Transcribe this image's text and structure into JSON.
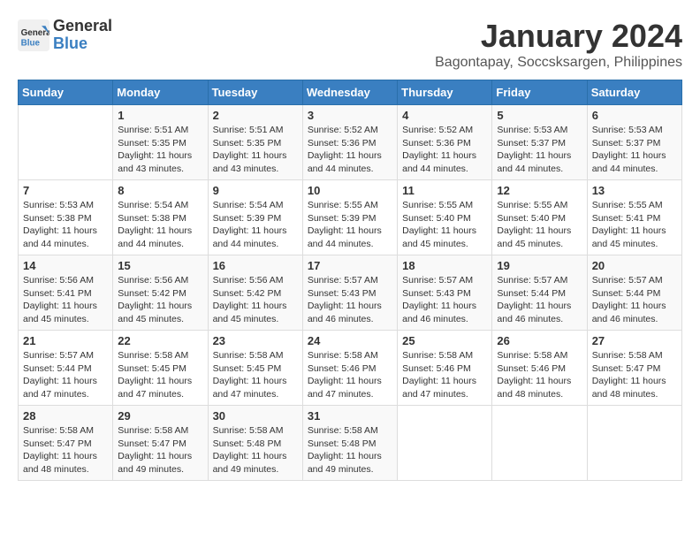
{
  "header": {
    "logo_line1": "General",
    "logo_line2": "Blue",
    "month_title": "January 2024",
    "location": "Bagontapay, Soccsksargen, Philippines"
  },
  "weekdays": [
    "Sunday",
    "Monday",
    "Tuesday",
    "Wednesday",
    "Thursday",
    "Friday",
    "Saturday"
  ],
  "weeks": [
    [
      {
        "day": "",
        "info": ""
      },
      {
        "day": "1",
        "info": "Sunrise: 5:51 AM\nSunset: 5:35 PM\nDaylight: 11 hours\nand 43 minutes."
      },
      {
        "day": "2",
        "info": "Sunrise: 5:51 AM\nSunset: 5:35 PM\nDaylight: 11 hours\nand 43 minutes."
      },
      {
        "day": "3",
        "info": "Sunrise: 5:52 AM\nSunset: 5:36 PM\nDaylight: 11 hours\nand 44 minutes."
      },
      {
        "day": "4",
        "info": "Sunrise: 5:52 AM\nSunset: 5:36 PM\nDaylight: 11 hours\nand 44 minutes."
      },
      {
        "day": "5",
        "info": "Sunrise: 5:53 AM\nSunset: 5:37 PM\nDaylight: 11 hours\nand 44 minutes."
      },
      {
        "day": "6",
        "info": "Sunrise: 5:53 AM\nSunset: 5:37 PM\nDaylight: 11 hours\nand 44 minutes."
      }
    ],
    [
      {
        "day": "7",
        "info": "Sunrise: 5:53 AM\nSunset: 5:38 PM\nDaylight: 11 hours\nand 44 minutes."
      },
      {
        "day": "8",
        "info": "Sunrise: 5:54 AM\nSunset: 5:38 PM\nDaylight: 11 hours\nand 44 minutes."
      },
      {
        "day": "9",
        "info": "Sunrise: 5:54 AM\nSunset: 5:39 PM\nDaylight: 11 hours\nand 44 minutes."
      },
      {
        "day": "10",
        "info": "Sunrise: 5:55 AM\nSunset: 5:39 PM\nDaylight: 11 hours\nand 44 minutes."
      },
      {
        "day": "11",
        "info": "Sunrise: 5:55 AM\nSunset: 5:40 PM\nDaylight: 11 hours\nand 45 minutes."
      },
      {
        "day": "12",
        "info": "Sunrise: 5:55 AM\nSunset: 5:40 PM\nDaylight: 11 hours\nand 45 minutes."
      },
      {
        "day": "13",
        "info": "Sunrise: 5:55 AM\nSunset: 5:41 PM\nDaylight: 11 hours\nand 45 minutes."
      }
    ],
    [
      {
        "day": "14",
        "info": "Sunrise: 5:56 AM\nSunset: 5:41 PM\nDaylight: 11 hours\nand 45 minutes."
      },
      {
        "day": "15",
        "info": "Sunrise: 5:56 AM\nSunset: 5:42 PM\nDaylight: 11 hours\nand 45 minutes."
      },
      {
        "day": "16",
        "info": "Sunrise: 5:56 AM\nSunset: 5:42 PM\nDaylight: 11 hours\nand 45 minutes."
      },
      {
        "day": "17",
        "info": "Sunrise: 5:57 AM\nSunset: 5:43 PM\nDaylight: 11 hours\nand 46 minutes."
      },
      {
        "day": "18",
        "info": "Sunrise: 5:57 AM\nSunset: 5:43 PM\nDaylight: 11 hours\nand 46 minutes."
      },
      {
        "day": "19",
        "info": "Sunrise: 5:57 AM\nSunset: 5:44 PM\nDaylight: 11 hours\nand 46 minutes."
      },
      {
        "day": "20",
        "info": "Sunrise: 5:57 AM\nSunset: 5:44 PM\nDaylight: 11 hours\nand 46 minutes."
      }
    ],
    [
      {
        "day": "21",
        "info": "Sunrise: 5:57 AM\nSunset: 5:44 PM\nDaylight: 11 hours\nand 47 minutes."
      },
      {
        "day": "22",
        "info": "Sunrise: 5:58 AM\nSunset: 5:45 PM\nDaylight: 11 hours\nand 47 minutes."
      },
      {
        "day": "23",
        "info": "Sunrise: 5:58 AM\nSunset: 5:45 PM\nDaylight: 11 hours\nand 47 minutes."
      },
      {
        "day": "24",
        "info": "Sunrise: 5:58 AM\nSunset: 5:46 PM\nDaylight: 11 hours\nand 47 minutes."
      },
      {
        "day": "25",
        "info": "Sunrise: 5:58 AM\nSunset: 5:46 PM\nDaylight: 11 hours\nand 47 minutes."
      },
      {
        "day": "26",
        "info": "Sunrise: 5:58 AM\nSunset: 5:46 PM\nDaylight: 11 hours\nand 48 minutes."
      },
      {
        "day": "27",
        "info": "Sunrise: 5:58 AM\nSunset: 5:47 PM\nDaylight: 11 hours\nand 48 minutes."
      }
    ],
    [
      {
        "day": "28",
        "info": "Sunrise: 5:58 AM\nSunset: 5:47 PM\nDaylight: 11 hours\nand 48 minutes."
      },
      {
        "day": "29",
        "info": "Sunrise: 5:58 AM\nSunset: 5:47 PM\nDaylight: 11 hours\nand 49 minutes."
      },
      {
        "day": "30",
        "info": "Sunrise: 5:58 AM\nSunset: 5:48 PM\nDaylight: 11 hours\nand 49 minutes."
      },
      {
        "day": "31",
        "info": "Sunrise: 5:58 AM\nSunset: 5:48 PM\nDaylight: 11 hours\nand 49 minutes."
      },
      {
        "day": "",
        "info": ""
      },
      {
        "day": "",
        "info": ""
      },
      {
        "day": "",
        "info": ""
      }
    ]
  ]
}
